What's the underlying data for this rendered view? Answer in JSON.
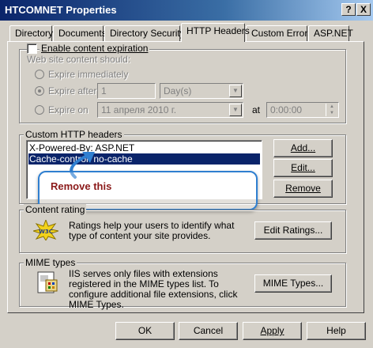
{
  "window": {
    "title": "HTCOMNET Properties",
    "help_btn": "?",
    "close_btn": "X"
  },
  "tabs": [
    "Directory",
    "Documents",
    "Directory Security",
    "HTTP Headers",
    "Custom Errors",
    "ASP.NET"
  ],
  "expiration": {
    "enable_label": "Enable content expiration",
    "web_site_label": "Web site content should:",
    "immediately": "Expire immediately",
    "after": "Expire after",
    "after_value": "1",
    "after_unit": "Day(s)",
    "on": "Expire on",
    "on_date": "11   апреля   2010 г.",
    "at_label": "at",
    "time": "0:00:00"
  },
  "custom_headers": {
    "legend": "Custom HTTP headers",
    "items": [
      "X-Powered-By: ASP.NET",
      "Cache-control: no-cache"
    ],
    "add": "Add...",
    "edit": "Edit...",
    "remove": "Remove"
  },
  "callout": {
    "text": "Remove this",
    "color": "#8b1a1a",
    "border": "#2f7fd0"
  },
  "content_rating": {
    "legend": "Content rating",
    "text": "Ratings help your users to identify what type of content your site provides.",
    "button": "Edit Ratings..."
  },
  "mime": {
    "legend": "MIME types",
    "text": "IIS serves only files with extensions registered in the MIME types list. To configure additional file extensions, click MIME Types.",
    "button": "MIME Types..."
  },
  "footer": {
    "ok": "OK",
    "cancel": "Cancel",
    "apply": "Apply",
    "help": "Help"
  }
}
